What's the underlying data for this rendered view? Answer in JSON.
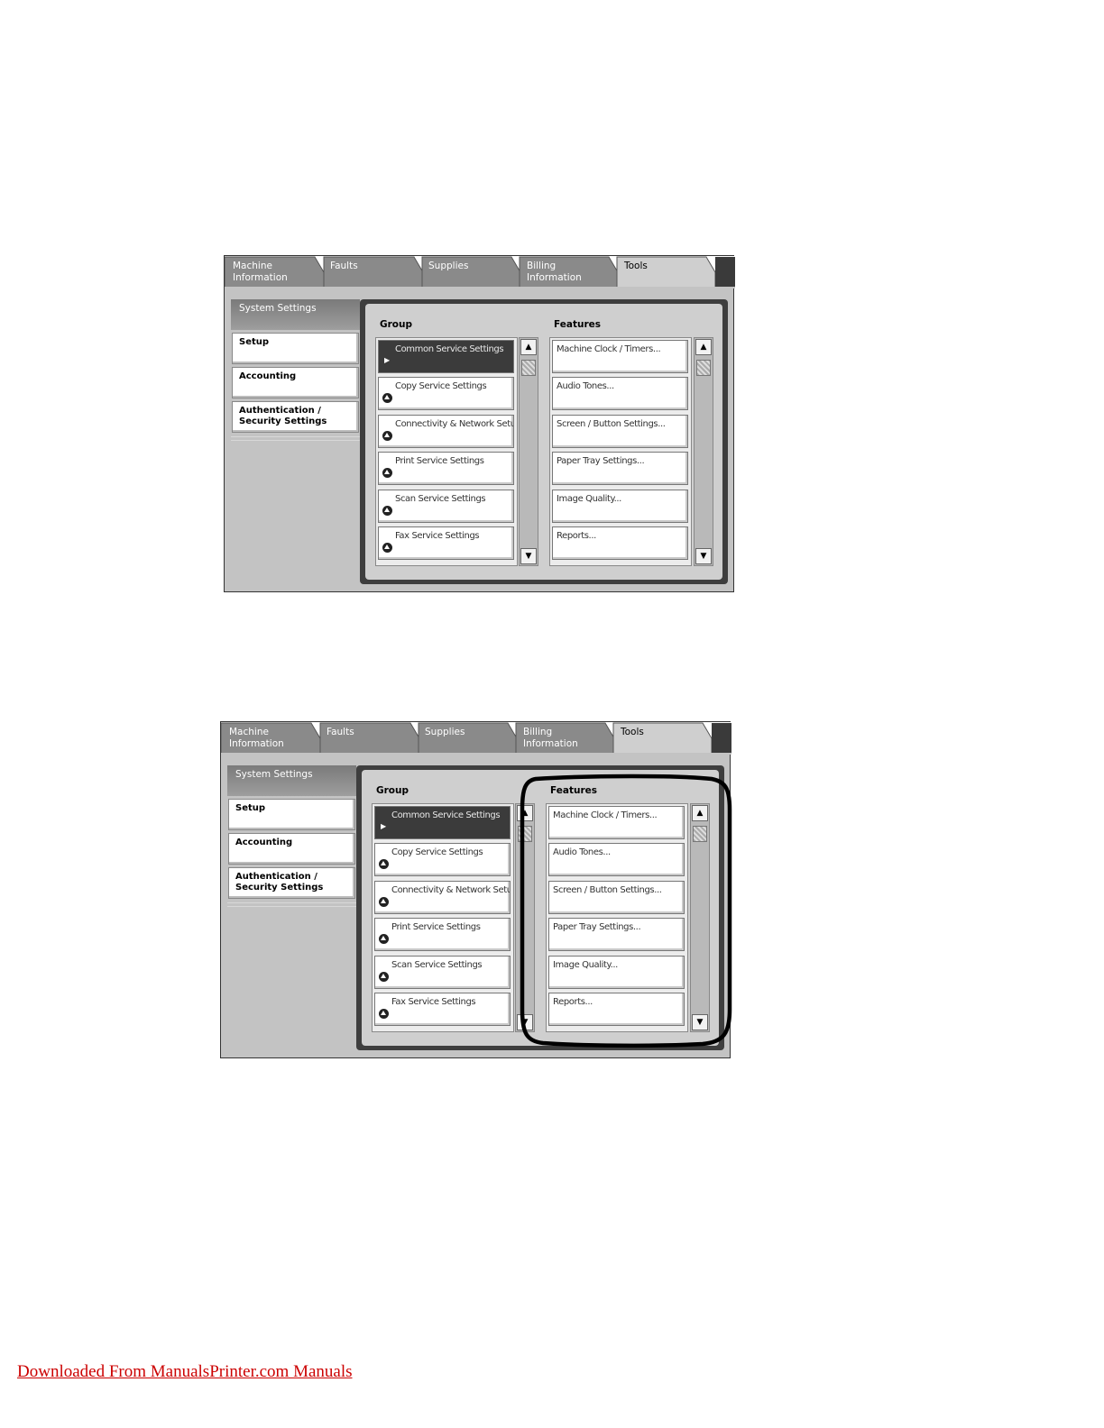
{
  "tabs": [
    {
      "label_1": "Machine",
      "label_2": "Information"
    },
    {
      "label_1": "Faults",
      "label_2": ""
    },
    {
      "label_1": "Supplies",
      "label_2": ""
    },
    {
      "label_1": "Billing",
      "label_2": "Information"
    },
    {
      "label_1": "Tools",
      "label_2": ""
    }
  ],
  "active_tab": "Tools",
  "sidebar": {
    "header": "System Settings",
    "items": [
      {
        "label_1": "Setup",
        "label_2": ""
      },
      {
        "label_1": "Accounting",
        "label_2": ""
      },
      {
        "label_1": "Authentication /",
        "label_2": "Security Settings"
      }
    ]
  },
  "group": {
    "header": "Group",
    "items": [
      "Common Service Settings",
      "Copy Service Settings",
      "Connectivity & Network Setup",
      "Print Service Settings",
      "Scan Service Settings",
      "Fax Service Settings"
    ],
    "selected_index": 0
  },
  "features": {
    "header": "Features",
    "items": [
      "Machine Clock / Timers...",
      "Audio Tones...",
      "Screen / Button Settings...",
      "Paper Tray Settings...",
      "Image Quality...",
      "Reports..."
    ]
  },
  "icons": {
    "group_item": "circle-up-arrow-icon",
    "selected_item": "play-arrow-icon",
    "scroll_up": "up-arrow-icon",
    "scroll_down": "down-arrow-icon"
  },
  "footer": "Downloaded From ManualsPrinter.com Manuals"
}
